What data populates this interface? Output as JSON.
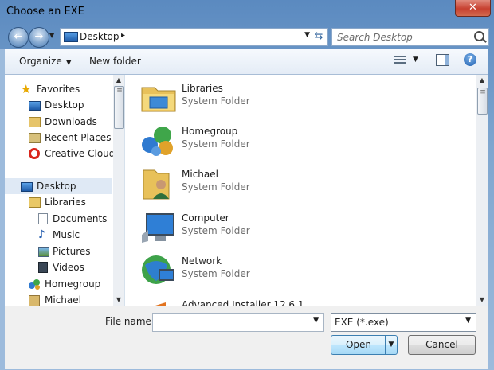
{
  "window": {
    "title": "Choose an EXE",
    "close_label": "✕"
  },
  "nav": {
    "back_icon": "back-arrow-icon",
    "forward_icon": "forward-arrow-icon",
    "address": {
      "location": "Desktop",
      "separator": "▸"
    },
    "search_placeholder": "Search Desktop"
  },
  "toolbar": {
    "organize_label": "Organize",
    "new_folder_label": "New folder",
    "help_label": "?"
  },
  "sidebar": {
    "favorites_label": "Favorites",
    "items": [
      {
        "label": "Desktop",
        "icon": "desktop-icon",
        "level": 1
      },
      {
        "label": "Downloads",
        "icon": "downloads-icon",
        "level": 1
      },
      {
        "label": "Recent Places",
        "icon": "recent-places-icon",
        "level": 1
      },
      {
        "label": "Creative Cloud F",
        "icon": "creative-cloud-icon",
        "level": 1
      }
    ],
    "tree": [
      {
        "label": "Desktop",
        "icon": "desktop-icon",
        "level": 0,
        "selected": true
      },
      {
        "label": "Libraries",
        "icon": "libraries-icon",
        "level": 1
      },
      {
        "label": "Documents",
        "icon": "documents-icon",
        "level": 2
      },
      {
        "label": "Music",
        "icon": "music-icon",
        "level": 2
      },
      {
        "label": "Pictures",
        "icon": "pictures-icon",
        "level": 2
      },
      {
        "label": "Videos",
        "icon": "videos-icon",
        "level": 2
      },
      {
        "label": "Homegroup",
        "icon": "homegroup-icon",
        "level": 1
      },
      {
        "label": "Michael",
        "icon": "user-icon",
        "level": 1
      }
    ]
  },
  "files": [
    {
      "name": "Libraries",
      "type": "System Folder",
      "icon": "libraries-folder-icon"
    },
    {
      "name": "Homegroup",
      "type": "System Folder",
      "icon": "homegroup-icon"
    },
    {
      "name": "Michael",
      "type": "System Folder",
      "icon": "user-folder-icon"
    },
    {
      "name": "Computer",
      "type": "System Folder",
      "icon": "computer-icon"
    },
    {
      "name": "Network",
      "type": "System Folder",
      "icon": "network-icon"
    },
    {
      "name": "Advanced Installer 12.6.1",
      "type": "",
      "icon": "installer-icon"
    }
  ],
  "footer": {
    "file_name_label": "File name:",
    "file_name_value": "",
    "file_type_value": "EXE (*.exe)",
    "open_label": "Open",
    "cancel_label": "Cancel"
  }
}
